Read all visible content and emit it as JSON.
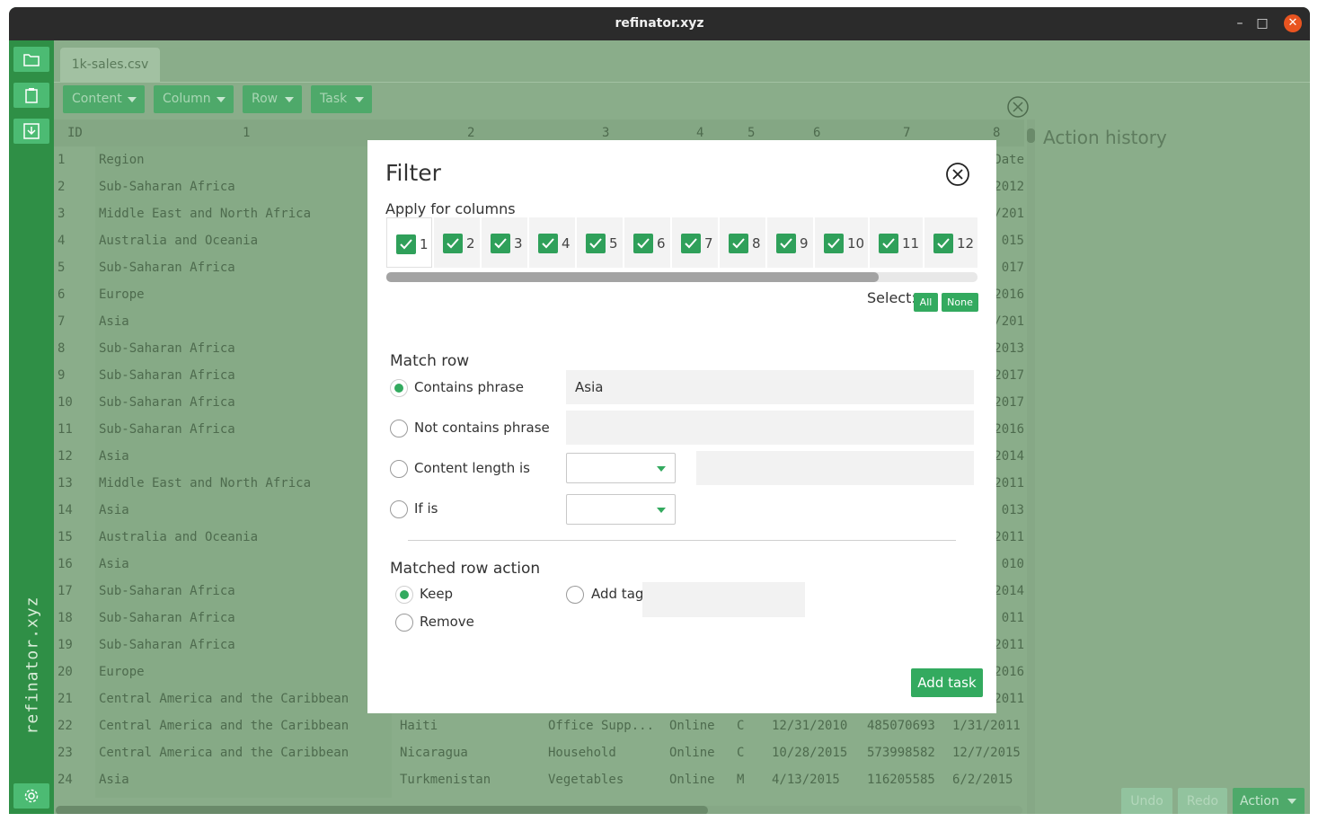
{
  "window": {
    "title": "refinator.xyz",
    "minimize": "–",
    "maximize": "□",
    "close": "✕"
  },
  "sidebar": {
    "brand": "refinator.xyz"
  },
  "file_tab": "1k-sales.csv",
  "menu": {
    "content": "Content",
    "column": "Column",
    "row": "Row",
    "task": "Task"
  },
  "table": {
    "headers": [
      "ID",
      "1",
      "2",
      "3",
      "4",
      "5",
      "6",
      "7",
      "8"
    ],
    "right_col_fragments": [
      "Date",
      "2012",
      "/201",
      "015",
      "017",
      "2016",
      "/201",
      "2013",
      "2017",
      "2017",
      "2016",
      "2014",
      "2011",
      "013",
      "2011",
      "010",
      "2014",
      "011",
      "2011",
      "2016",
      "2011"
    ],
    "rows": [
      {
        "id": "1",
        "region": "Region"
      },
      {
        "id": "2",
        "region": "Sub-Saharan Africa"
      },
      {
        "id": "3",
        "region": "Middle East and North Africa"
      },
      {
        "id": "4",
        "region": "Australia and Oceania"
      },
      {
        "id": "5",
        "region": "Sub-Saharan Africa"
      },
      {
        "id": "6",
        "region": "Europe"
      },
      {
        "id": "7",
        "region": "Asia"
      },
      {
        "id": "8",
        "region": "Sub-Saharan Africa"
      },
      {
        "id": "9",
        "region": "Sub-Saharan Africa"
      },
      {
        "id": "10",
        "region": "Sub-Saharan Africa"
      },
      {
        "id": "11",
        "region": "Sub-Saharan Africa"
      },
      {
        "id": "12",
        "region": "Asia"
      },
      {
        "id": "13",
        "region": "Middle East and North Africa"
      },
      {
        "id": "14",
        "region": "Asia"
      },
      {
        "id": "15",
        "region": "Australia and Oceania"
      },
      {
        "id": "16",
        "region": "Asia"
      },
      {
        "id": "17",
        "region": "Sub-Saharan Africa"
      },
      {
        "id": "18",
        "region": "Sub-Saharan Africa"
      },
      {
        "id": "19",
        "region": "Sub-Saharan Africa"
      },
      {
        "id": "20",
        "region": "Europe"
      },
      {
        "id": "21",
        "region": "Central America and the Caribbean"
      }
    ],
    "bottom_rows": [
      {
        "id": "22",
        "region": "Central America and the Caribbean",
        "country": "Haiti",
        "item": "Office Supp...",
        "channel": "Online",
        "priority": "C",
        "order_date": "12/31/2010",
        "order_id": "485070693",
        "ship_date": "1/31/2011"
      },
      {
        "id": "23",
        "region": "Central America and the Caribbean",
        "country": "Nicaragua",
        "item": "Household",
        "channel": "Online",
        "priority": "C",
        "order_date": "10/28/2015",
        "order_id": "573998582",
        "ship_date": "12/7/2015"
      },
      {
        "id": "24",
        "region": "Asia",
        "country": "Turkmenistan",
        "item": "Vegetables",
        "channel": "Online",
        "priority": "M",
        "order_date": "4/13/2015",
        "order_id": "116205585",
        "ship_date": "6/2/2015"
      }
    ]
  },
  "history": {
    "title": "Action history",
    "undo": "Undo",
    "redo": "Redo",
    "action": "Action"
  },
  "filter": {
    "title": "Filter",
    "apply_label": "Apply for columns",
    "columns": [
      "1",
      "2",
      "3",
      "4",
      "5",
      "6",
      "7",
      "8",
      "9",
      "10",
      "11",
      "12"
    ],
    "select_label": "Select:",
    "select_all": "All",
    "select_none": "None",
    "match_row_title": "Match row",
    "contains_label": "Contains phrase",
    "contains_value": "Asia",
    "not_contains_label": "Not contains phrase",
    "not_contains_value": "",
    "length_label": "Content length is",
    "length_value": "",
    "ifis_label": "If is",
    "action_title": "Matched row action",
    "keep_label": "Keep",
    "remove_label": "Remove",
    "add_tag_label": "Add tag",
    "add_tag_value": "",
    "add_task_button": "Add task",
    "selected_match": "contains",
    "selected_action": "keep"
  },
  "colors": {
    "accent": "#33aa5f",
    "sidebar": "#2f8f46",
    "overlay_bg": "#8aad8a"
  }
}
